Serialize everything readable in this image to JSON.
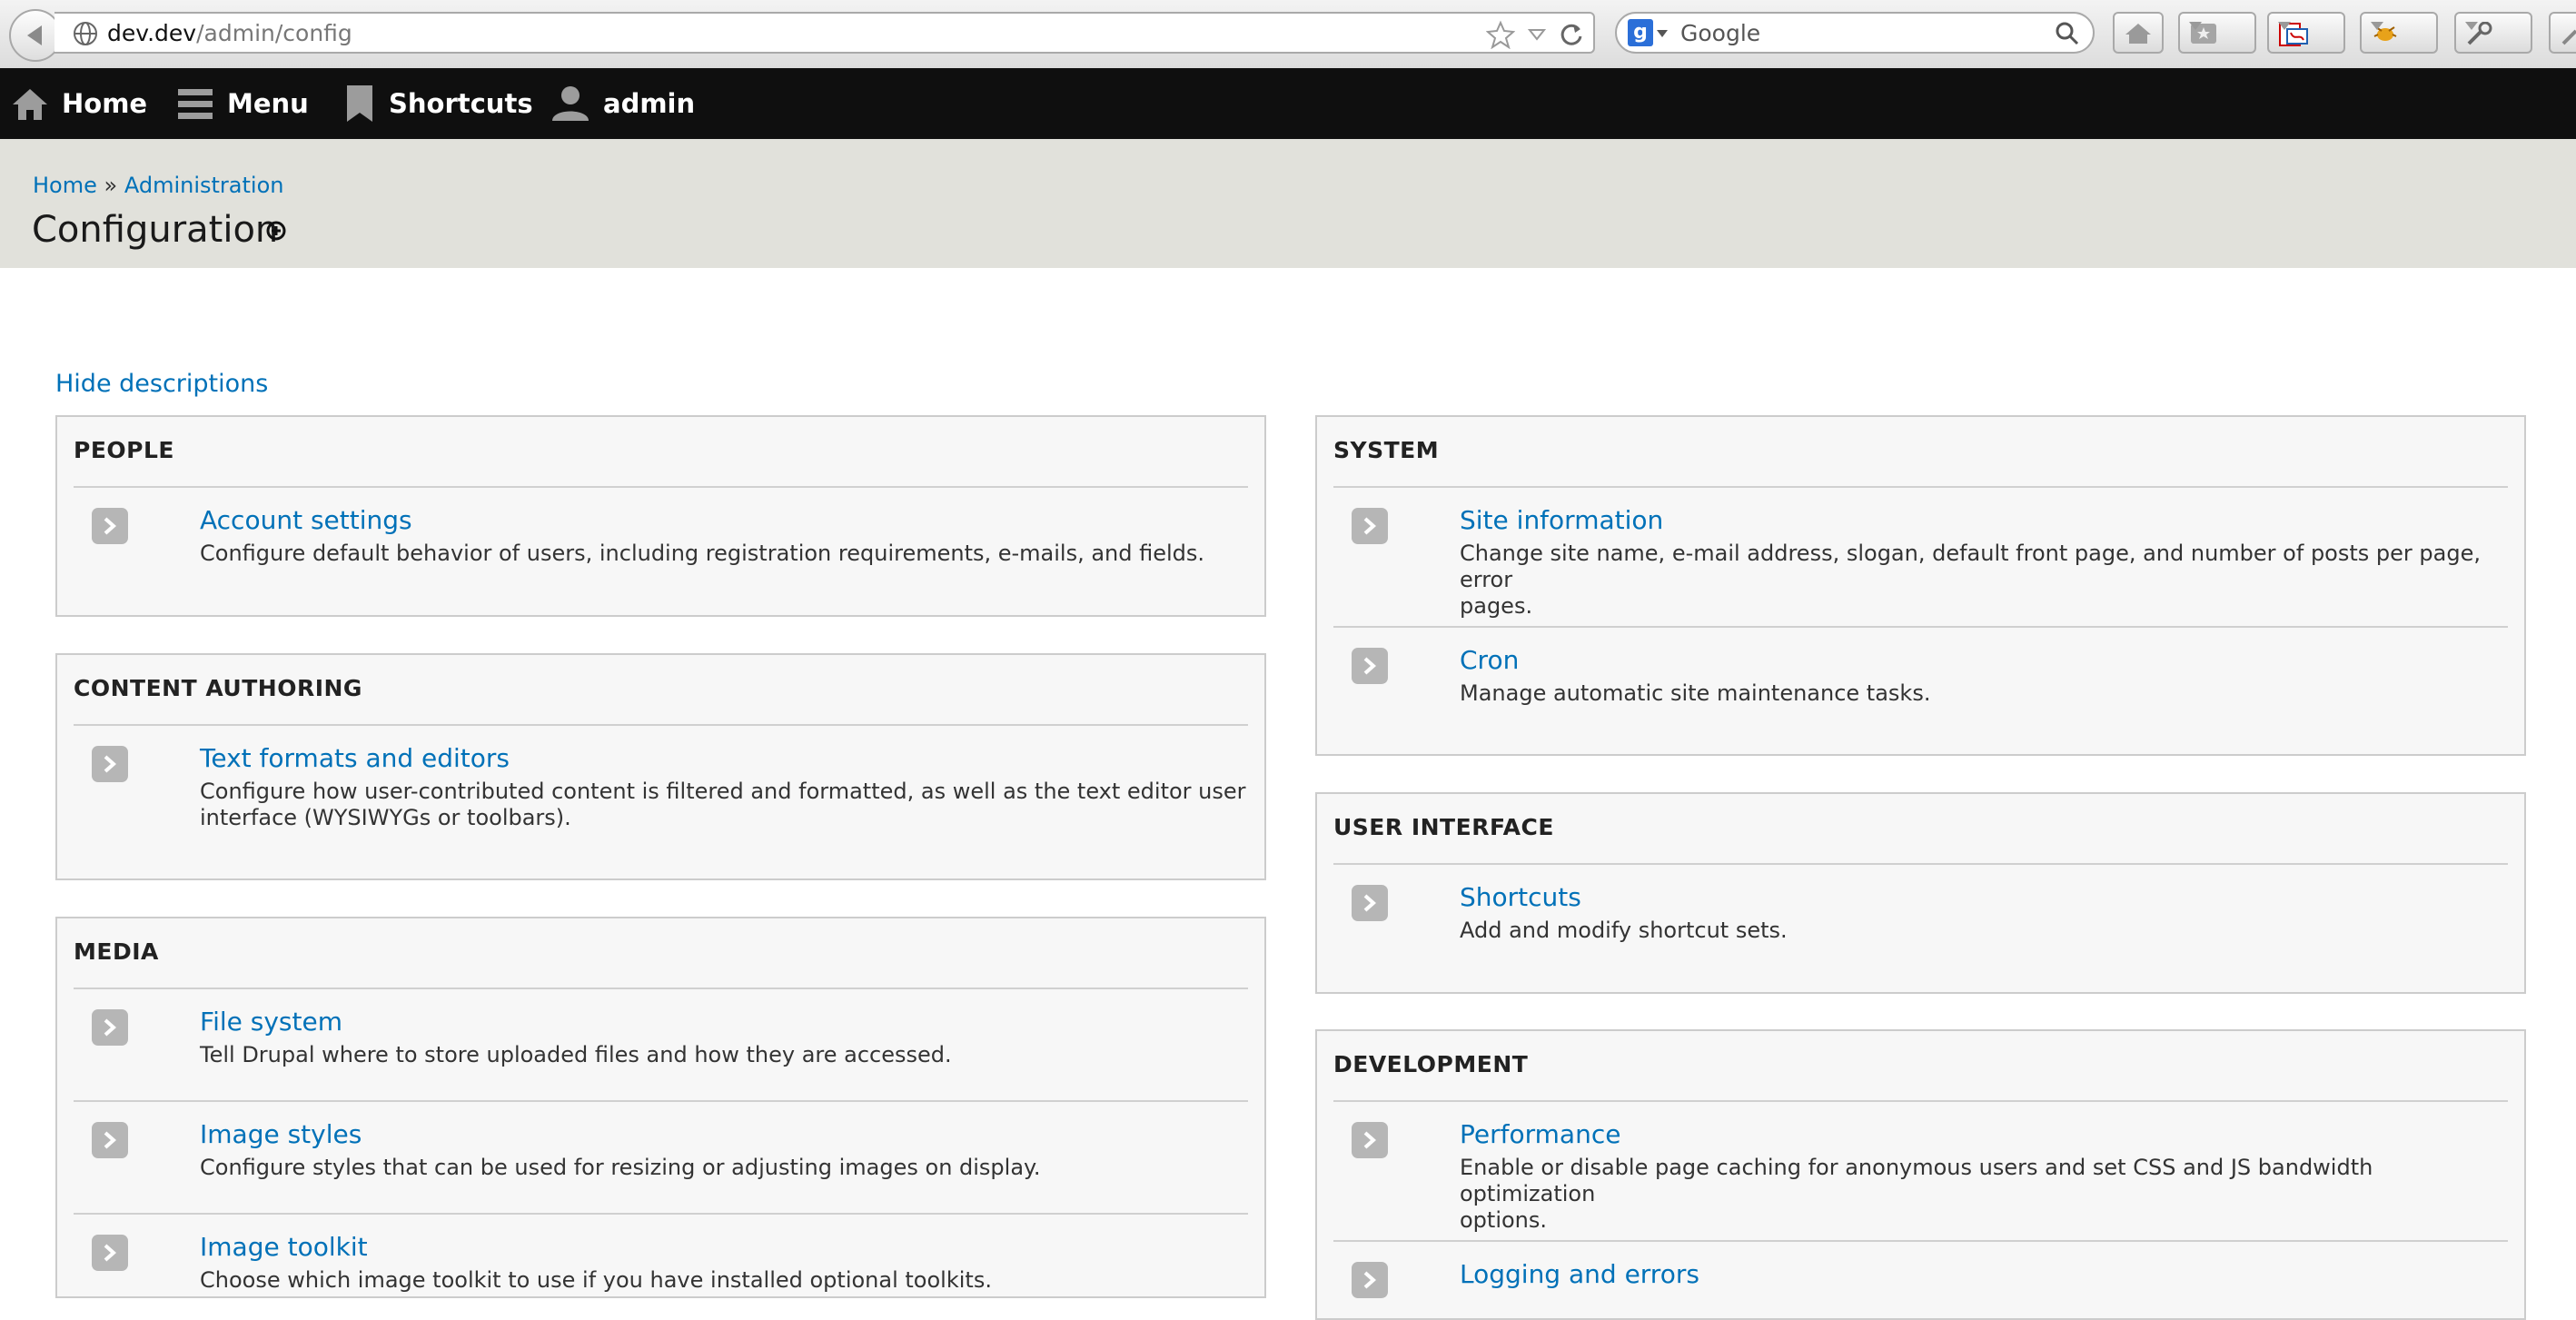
{
  "browser": {
    "url_host": "dev.dev",
    "url_path": "/admin/config",
    "search_placeholder": "Google"
  },
  "toolbar": {
    "items": [
      {
        "label": "Home",
        "icon": "home-icon"
      },
      {
        "label": "Menu",
        "icon": "menu-icon"
      },
      {
        "label": "Shortcuts",
        "icon": "bookmark-icon"
      },
      {
        "label": "admin",
        "icon": "user-icon"
      }
    ]
  },
  "breadcrumb": {
    "home": "Home",
    "separator": "»",
    "administration": "Administration"
  },
  "page_title": "Configuration",
  "hide_descriptions": "Hide descriptions",
  "panels": {
    "people": {
      "title": "PEOPLE",
      "entries": [
        {
          "label": "Account settings",
          "description": "Configure default behavior of users, including registration requirements, e-mails, and fields."
        }
      ]
    },
    "content_authoring": {
      "title": "CONTENT AUTHORING",
      "entries": [
        {
          "label": "Text formats and editors",
          "description_lines": [
            "Configure how user-contributed content is filtered and formatted, as well as the text editor user",
            "interface (WYSIWYGs or toolbars)."
          ]
        }
      ]
    },
    "media": {
      "title": "MEDIA",
      "entries": [
        {
          "label": "File system",
          "description": "Tell Drupal where to store uploaded files and how they are accessed."
        },
        {
          "label": "Image styles",
          "description": "Configure styles that can be used for resizing or adjusting images on display."
        },
        {
          "label": "Image toolkit",
          "description": "Choose which image toolkit to use if you have installed optional toolkits."
        }
      ]
    },
    "system": {
      "title": "SYSTEM",
      "entries": [
        {
          "label": "Site information",
          "description_lines": [
            "Change site name, e-mail address, slogan, default front page, and number of posts per page, error",
            "pages."
          ]
        },
        {
          "label": "Cron",
          "description": "Manage automatic site maintenance tasks."
        }
      ]
    },
    "user_interface": {
      "title": "USER INTERFACE",
      "entries": [
        {
          "label": "Shortcuts",
          "description": "Add and modify shortcut sets."
        }
      ]
    },
    "development": {
      "title": "DEVELOPMENT",
      "entries": [
        {
          "label": "Performance",
          "description_lines": [
            "Enable or disable page caching for anonymous users and set CSS and JS bandwidth optimization",
            "options."
          ]
        },
        {
          "label": "Logging and errors",
          "description": ""
        }
      ]
    }
  },
  "colors": {
    "link": "#0071b8",
    "admin_bar": "#0f0f0f",
    "header_band": "#e1e1db",
    "panel_bg": "#f7f7f7"
  }
}
